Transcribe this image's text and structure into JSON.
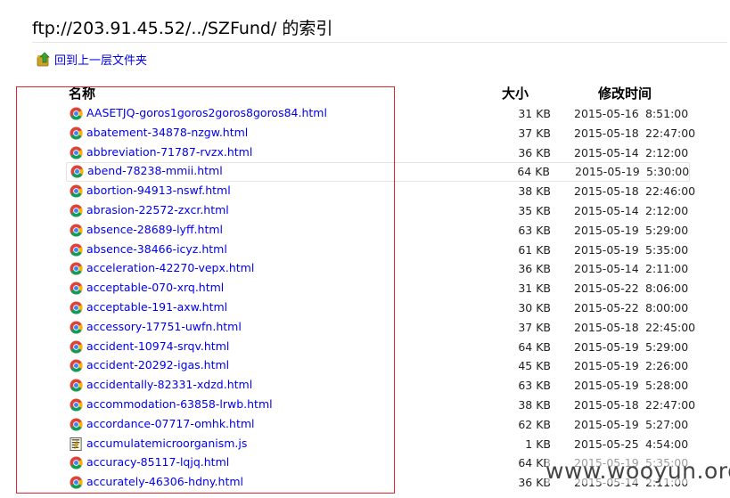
{
  "page": {
    "title": "ftp://203.91.45.52/../SZFund/ 的索引",
    "parent_link": "回到上一层文件夹"
  },
  "columns": {
    "name": "名称",
    "size": "大小",
    "modified": "修改时间"
  },
  "hovered_row_index": 3,
  "files": [
    {
      "name": "AASETJQ-goros1goros2goros8goros84.html",
      "size": "31 KB",
      "date": "2015-05-16",
      "time": "8:51:00",
      "icon": "chrome-html-icon"
    },
    {
      "name": "abatement-34878-nzgw.html",
      "size": "37 KB",
      "date": "2015-05-18",
      "time": "22:47:00",
      "icon": "chrome-html-icon"
    },
    {
      "name": "abbreviation-71787-rvzx.html",
      "size": "36 KB",
      "date": "2015-05-14",
      "time": "2:12:00",
      "icon": "chrome-html-icon"
    },
    {
      "name": "abend-78238-mmii.html",
      "size": "64 KB",
      "date": "2015-05-19",
      "time": "5:30:00",
      "icon": "chrome-html-icon"
    },
    {
      "name": "abortion-94913-nswf.html",
      "size": "38 KB",
      "date": "2015-05-18",
      "time": "22:46:00",
      "icon": "chrome-html-icon"
    },
    {
      "name": "abrasion-22572-zxcr.html",
      "size": "35 KB",
      "date": "2015-05-14",
      "time": "2:12:00",
      "icon": "chrome-html-icon"
    },
    {
      "name": "absence-28689-lyff.html",
      "size": "63 KB",
      "date": "2015-05-19",
      "time": "5:29:00",
      "icon": "chrome-html-icon"
    },
    {
      "name": "absence-38466-icyz.html",
      "size": "61 KB",
      "date": "2015-05-19",
      "time": "5:35:00",
      "icon": "chrome-html-icon"
    },
    {
      "name": "acceleration-42270-vepx.html",
      "size": "36 KB",
      "date": "2015-05-14",
      "time": "2:11:00",
      "icon": "chrome-html-icon"
    },
    {
      "name": "acceptable-070-xrq.html",
      "size": "31 KB",
      "date": "2015-05-22",
      "time": "8:06:00",
      "icon": "chrome-html-icon"
    },
    {
      "name": "acceptable-191-axw.html",
      "size": "30 KB",
      "date": "2015-05-22",
      "time": "8:00:00",
      "icon": "chrome-html-icon"
    },
    {
      "name": "accessory-17751-uwfn.html",
      "size": "37 KB",
      "date": "2015-05-18",
      "time": "22:45:00",
      "icon": "chrome-html-icon"
    },
    {
      "name": "accident-10974-srqv.html",
      "size": "64 KB",
      "date": "2015-05-19",
      "time": "5:29:00",
      "icon": "chrome-html-icon"
    },
    {
      "name": "accident-20292-igas.html",
      "size": "45 KB",
      "date": "2015-05-19",
      "time": "2:26:00",
      "icon": "chrome-html-icon"
    },
    {
      "name": "accidentally-82331-xdzd.html",
      "size": "63 KB",
      "date": "2015-05-19",
      "time": "5:28:00",
      "icon": "chrome-html-icon"
    },
    {
      "name": "accommodation-63858-lrwb.html",
      "size": "38 KB",
      "date": "2015-05-18",
      "time": "22:47:00",
      "icon": "chrome-html-icon"
    },
    {
      "name": "accordance-07717-omhk.html",
      "size": "62 KB",
      "date": "2015-05-19",
      "time": "5:27:00",
      "icon": "chrome-html-icon"
    },
    {
      "name": "accumulatemicroorganism.js",
      "size": "1 KB",
      "date": "2015-05-25",
      "time": "4:54:00",
      "icon": "script-file-icon"
    },
    {
      "name": "accuracy-85117-lqjq.html",
      "size": "64 KB",
      "date": "2015-05-19",
      "time": "5:35:00",
      "icon": "chrome-html-icon"
    },
    {
      "name": "accurately-46306-hdny.html",
      "size": "36 KB",
      "date": "2015-05-14",
      "time": "2:11:00",
      "icon": "chrome-html-icon"
    }
  ],
  "watermark": "www.wooyun.org",
  "colors": {
    "link": "#0000ee",
    "highlight_box": "#e0242c"
  }
}
